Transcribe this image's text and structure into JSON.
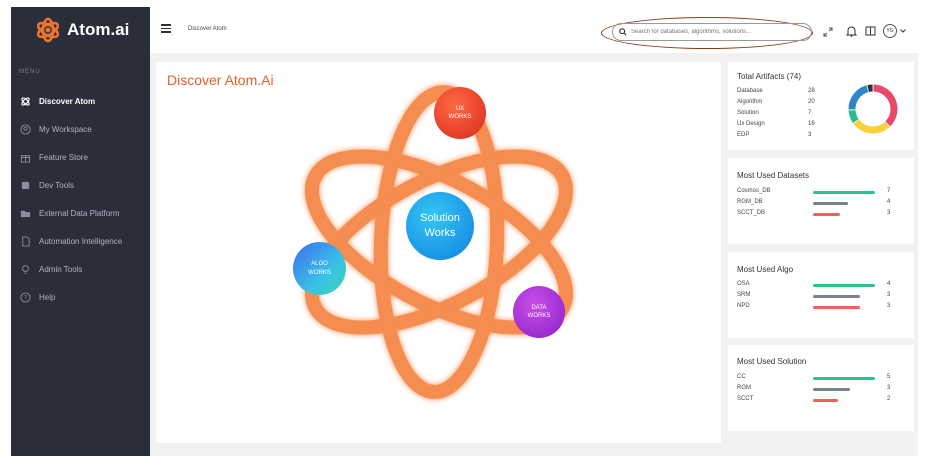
{
  "brand": {
    "name": "Atom.ai"
  },
  "sidebar": {
    "menu_heading": "MENU",
    "items": [
      {
        "label": "Discover Atom",
        "icon": "atom-icon",
        "active": true
      },
      {
        "label": "My Workspace",
        "icon": "user-icon"
      },
      {
        "label": "Feature Store",
        "icon": "gift-icon"
      },
      {
        "label": "Dev Tools",
        "icon": "wrench-icon"
      },
      {
        "label": "External Data Platform",
        "icon": "folder-icon"
      },
      {
        "label": "Automation Intelligence",
        "icon": "document-icon"
      },
      {
        "label": "Admin Tools",
        "icon": "bulb-icon"
      },
      {
        "label": "Help",
        "icon": "help-icon"
      }
    ]
  },
  "topbar": {
    "breadcrumb": "Discover Atom",
    "search_placeholder": "Search for databases, algorithms, solutions...",
    "avatar_initials": "YG"
  },
  "main": {
    "title": "Discover Atom.Ai",
    "orbs": {
      "ux": {
        "line1": "UX",
        "line2": "WORKS"
      },
      "algo": {
        "line1": "ALGO",
        "line2": "WORKS"
      },
      "solution": {
        "line1": "Solution",
        "line2": "Works"
      },
      "data": {
        "line1": "DATA",
        "line2": "WORKS"
      }
    }
  },
  "artifacts": {
    "title": "Total Artifacts (74)",
    "rows": [
      {
        "label": "Database",
        "value": 28,
        "color": "#e8486b"
      },
      {
        "label": "Algorithm",
        "value": 20,
        "color": "#fbd03c"
      },
      {
        "label": "Solution",
        "value": 7,
        "color": "#2dbd88"
      },
      {
        "label": "Ux Design",
        "value": 16,
        "color": "#2f86c4"
      },
      {
        "label": "EDP",
        "value": 3,
        "color": "#2b3244"
      }
    ]
  },
  "datasets": {
    "title": "Most Used Datasets",
    "rows": [
      {
        "label": "Cosmos_DB",
        "value": 7,
        "color": "#2ec28b"
      },
      {
        "label": "RGM_DB",
        "value": 4,
        "color": "#7a7f8c"
      },
      {
        "label": "SCCT_DB",
        "value": 3,
        "color": "#f0605d"
      }
    ],
    "max": 7
  },
  "algos": {
    "title": "Most Used Algo",
    "rows": [
      {
        "label": "OSA",
        "value": 4,
        "color": "#2ec28b"
      },
      {
        "label": "SRM",
        "value": 3,
        "color": "#7a7f8c"
      },
      {
        "label": "NPD",
        "value": 3,
        "color": "#f0605d"
      }
    ],
    "max": 4
  },
  "solutions": {
    "title": "Most Used Solution",
    "rows": [
      {
        "label": "CC",
        "value": 5,
        "color": "#2ec28b"
      },
      {
        "label": "RGM",
        "value": 3,
        "color": "#7a7f8c"
      },
      {
        "label": "SCCT",
        "value": 2,
        "color": "#f0605d"
      }
    ],
    "max": 5
  }
}
